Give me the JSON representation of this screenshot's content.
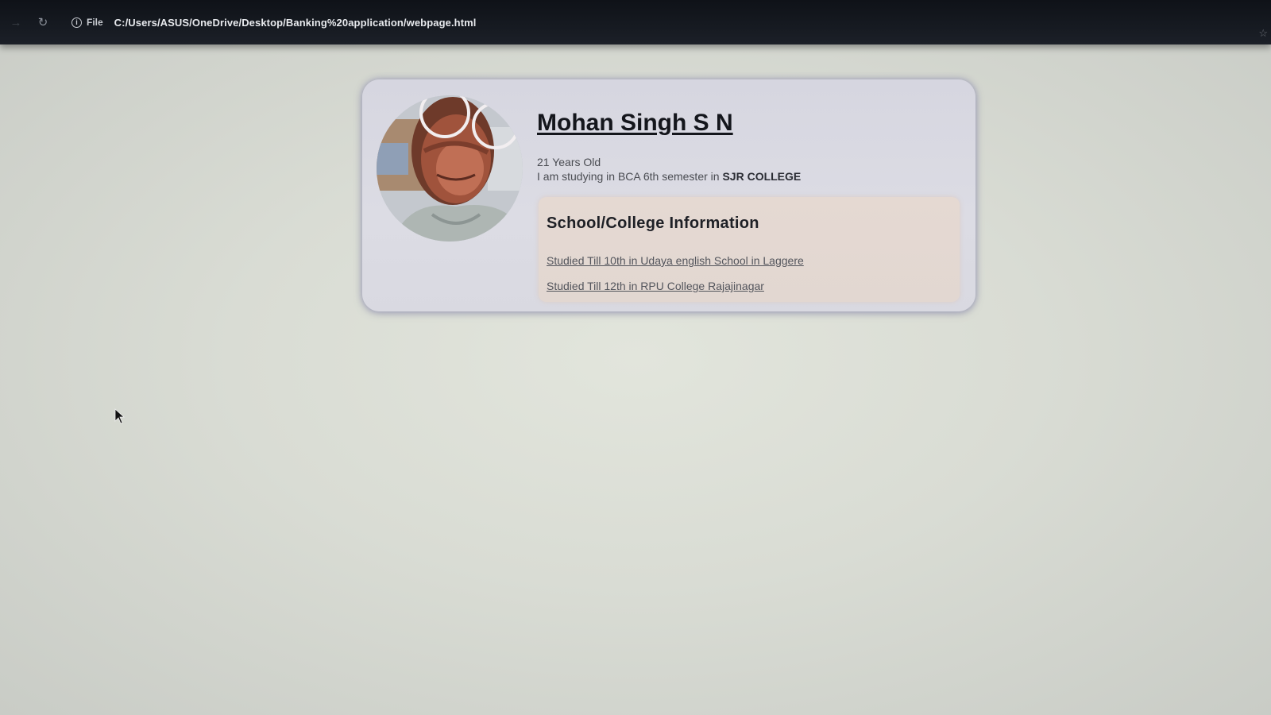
{
  "browser": {
    "address_prefix": "File",
    "url": "C:/Users/ASUS/OneDrive/Desktop/Banking%20application/webpage.html"
  },
  "profile": {
    "name": "Mohan Singh S N",
    "age_text": "21 Years Old",
    "study_text": "I am studying in BCA 6th semester in ",
    "college": "SJR COLLEGE"
  },
  "education": {
    "heading": "School/College Information",
    "items": [
      "Studied Till 10th in Udaya english School in Laggere",
      "Studied Till 12th in RPU College Rajajinagar"
    ]
  }
}
